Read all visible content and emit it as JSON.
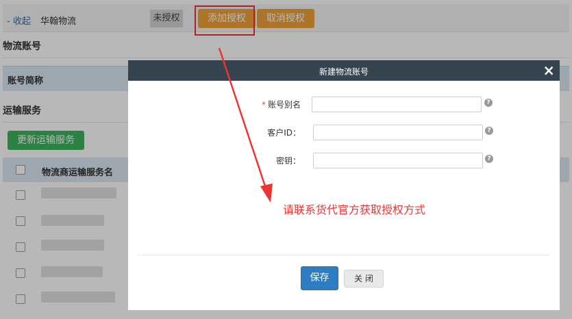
{
  "top_bar": {
    "collapse_label": "- 收起",
    "carrier_name": "华翰物流",
    "status": "未授权",
    "add_auth_label": "添加授权",
    "cancel_auth_label": "取消授权"
  },
  "account_section": {
    "title": "物流账号",
    "column_header": "账号简称"
  },
  "transport_section": {
    "title": "运输服务",
    "update_button": "更新运输服务",
    "column_header": "物流商运输服务名",
    "row_count": 5
  },
  "modal": {
    "title": "新建物流账号",
    "close_symbol": "×",
    "fields": [
      {
        "label": "账号别名",
        "required": true,
        "value": ""
      },
      {
        "label": "客户ID：",
        "required": false,
        "value": ""
      },
      {
        "label": "密钥：",
        "required": false,
        "value": ""
      }
    ],
    "help_symbol": "?",
    "save_label": "保存",
    "close_label": "关 闭"
  },
  "annotation": {
    "text": "请联系货代官方获取授权方式",
    "color": "#e33333"
  },
  "colors": {
    "accent_orange": "#f0a33a",
    "accent_green": "#3cb55e",
    "save_blue": "#2f7dc1",
    "modal_header": "#36444f"
  }
}
